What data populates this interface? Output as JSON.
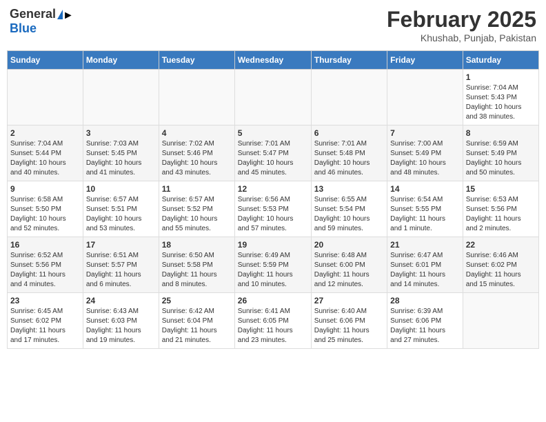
{
  "header": {
    "logo_general": "General",
    "logo_blue": "Blue",
    "month_title": "February 2025",
    "location": "Khushab, Punjab, Pakistan"
  },
  "days_of_week": [
    "Sunday",
    "Monday",
    "Tuesday",
    "Wednesday",
    "Thursday",
    "Friday",
    "Saturday"
  ],
  "weeks": [
    [
      {
        "day": "",
        "info": ""
      },
      {
        "day": "",
        "info": ""
      },
      {
        "day": "",
        "info": ""
      },
      {
        "day": "",
        "info": ""
      },
      {
        "day": "",
        "info": ""
      },
      {
        "day": "",
        "info": ""
      },
      {
        "day": "1",
        "info": "Sunrise: 7:04 AM\nSunset: 5:43 PM\nDaylight: 10 hours\nand 38 minutes."
      }
    ],
    [
      {
        "day": "2",
        "info": "Sunrise: 7:04 AM\nSunset: 5:44 PM\nDaylight: 10 hours\nand 40 minutes."
      },
      {
        "day": "3",
        "info": "Sunrise: 7:03 AM\nSunset: 5:45 PM\nDaylight: 10 hours\nand 41 minutes."
      },
      {
        "day": "4",
        "info": "Sunrise: 7:02 AM\nSunset: 5:46 PM\nDaylight: 10 hours\nand 43 minutes."
      },
      {
        "day": "5",
        "info": "Sunrise: 7:01 AM\nSunset: 5:47 PM\nDaylight: 10 hours\nand 45 minutes."
      },
      {
        "day": "6",
        "info": "Sunrise: 7:01 AM\nSunset: 5:48 PM\nDaylight: 10 hours\nand 46 minutes."
      },
      {
        "day": "7",
        "info": "Sunrise: 7:00 AM\nSunset: 5:49 PM\nDaylight: 10 hours\nand 48 minutes."
      },
      {
        "day": "8",
        "info": "Sunrise: 6:59 AM\nSunset: 5:49 PM\nDaylight: 10 hours\nand 50 minutes."
      }
    ],
    [
      {
        "day": "9",
        "info": "Sunrise: 6:58 AM\nSunset: 5:50 PM\nDaylight: 10 hours\nand 52 minutes."
      },
      {
        "day": "10",
        "info": "Sunrise: 6:57 AM\nSunset: 5:51 PM\nDaylight: 10 hours\nand 53 minutes."
      },
      {
        "day": "11",
        "info": "Sunrise: 6:57 AM\nSunset: 5:52 PM\nDaylight: 10 hours\nand 55 minutes."
      },
      {
        "day": "12",
        "info": "Sunrise: 6:56 AM\nSunset: 5:53 PM\nDaylight: 10 hours\nand 57 minutes."
      },
      {
        "day": "13",
        "info": "Sunrise: 6:55 AM\nSunset: 5:54 PM\nDaylight: 10 hours\nand 59 minutes."
      },
      {
        "day": "14",
        "info": "Sunrise: 6:54 AM\nSunset: 5:55 PM\nDaylight: 11 hours\nand 1 minute."
      },
      {
        "day": "15",
        "info": "Sunrise: 6:53 AM\nSunset: 5:56 PM\nDaylight: 11 hours\nand 2 minutes."
      }
    ],
    [
      {
        "day": "16",
        "info": "Sunrise: 6:52 AM\nSunset: 5:56 PM\nDaylight: 11 hours\nand 4 minutes."
      },
      {
        "day": "17",
        "info": "Sunrise: 6:51 AM\nSunset: 5:57 PM\nDaylight: 11 hours\nand 6 minutes."
      },
      {
        "day": "18",
        "info": "Sunrise: 6:50 AM\nSunset: 5:58 PM\nDaylight: 11 hours\nand 8 minutes."
      },
      {
        "day": "19",
        "info": "Sunrise: 6:49 AM\nSunset: 5:59 PM\nDaylight: 11 hours\nand 10 minutes."
      },
      {
        "day": "20",
        "info": "Sunrise: 6:48 AM\nSunset: 6:00 PM\nDaylight: 11 hours\nand 12 minutes."
      },
      {
        "day": "21",
        "info": "Sunrise: 6:47 AM\nSunset: 6:01 PM\nDaylight: 11 hours\nand 14 minutes."
      },
      {
        "day": "22",
        "info": "Sunrise: 6:46 AM\nSunset: 6:02 PM\nDaylight: 11 hours\nand 15 minutes."
      }
    ],
    [
      {
        "day": "23",
        "info": "Sunrise: 6:45 AM\nSunset: 6:02 PM\nDaylight: 11 hours\nand 17 minutes."
      },
      {
        "day": "24",
        "info": "Sunrise: 6:43 AM\nSunset: 6:03 PM\nDaylight: 11 hours\nand 19 minutes."
      },
      {
        "day": "25",
        "info": "Sunrise: 6:42 AM\nSunset: 6:04 PM\nDaylight: 11 hours\nand 21 minutes."
      },
      {
        "day": "26",
        "info": "Sunrise: 6:41 AM\nSunset: 6:05 PM\nDaylight: 11 hours\nand 23 minutes."
      },
      {
        "day": "27",
        "info": "Sunrise: 6:40 AM\nSunset: 6:06 PM\nDaylight: 11 hours\nand 25 minutes."
      },
      {
        "day": "28",
        "info": "Sunrise: 6:39 AM\nSunset: 6:06 PM\nDaylight: 11 hours\nand 27 minutes."
      },
      {
        "day": "",
        "info": ""
      }
    ]
  ]
}
